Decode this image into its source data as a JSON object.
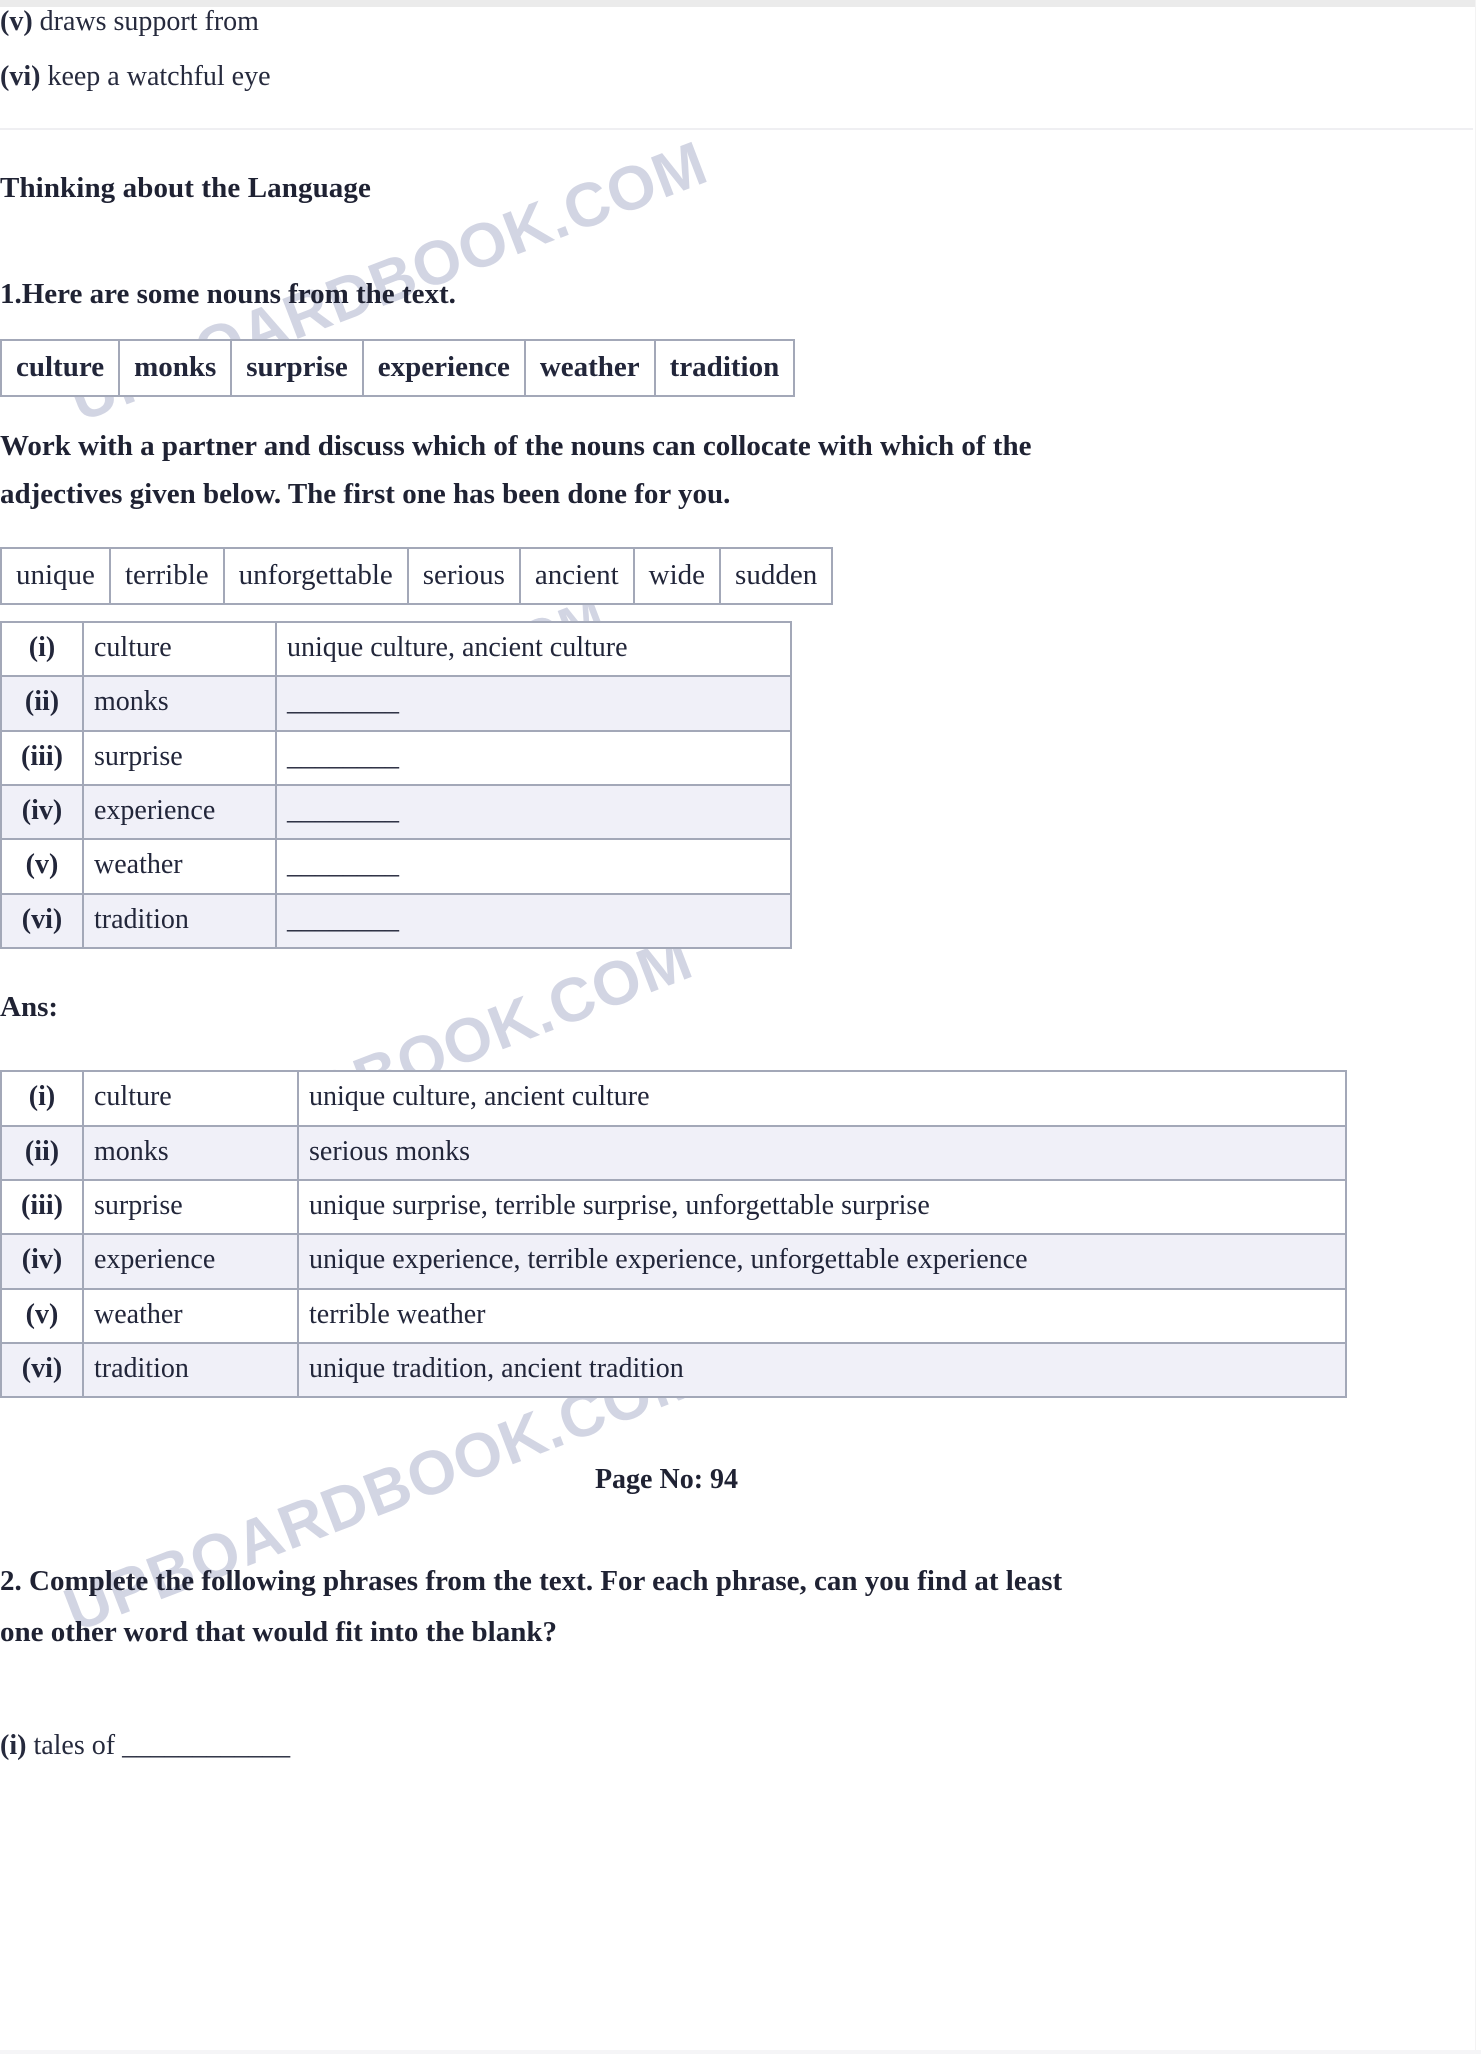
{
  "colors": {
    "text": "#22263a",
    "table_border": "#a3a8b8",
    "row_alt_bg": "#f0f0f8",
    "watermark": "#c9ccdd",
    "top_band": "#ebebeb"
  },
  "watermark": {
    "text": "UPBOARDBOOK.COM",
    "repeats": 4
  },
  "top_phrases": [
    {
      "numeral": "(v)",
      "text": "draws support from"
    },
    {
      "numeral": "(vi)",
      "text": "keep a watchful eye"
    }
  ],
  "section": {
    "title": "Thinking about the Language"
  },
  "question1": {
    "heading": "1.Here are some nouns from the text.",
    "nouns": [
      "culture",
      "monks",
      "surprise",
      "experience",
      "weather",
      "tradition"
    ],
    "instruction_line1": "Work with a partner and discuss which of the nouns can collocate with which of the",
    "instruction_line2": "adjectives given below. The first one has been done for you.",
    "adjectives": [
      "unique",
      "terrible",
      "unforgettable",
      "serious",
      "ancient",
      "wide",
      "sudden"
    ],
    "exercise_rows": [
      {
        "numeral": "(i)",
        "noun": "culture",
        "value": "unique culture, ancient culture"
      },
      {
        "numeral": "(ii)",
        "noun": "monks",
        "value": "________"
      },
      {
        "numeral": "(iii)",
        "noun": "surprise",
        "value": "________"
      },
      {
        "numeral": "(iv)",
        "noun": "experience",
        "value": "________"
      },
      {
        "numeral": "(v)",
        "noun": "weather",
        "value": "________"
      },
      {
        "numeral": "(vi)",
        "noun": "tradition",
        "value": "________"
      }
    ],
    "answer_label": "Ans:",
    "answer_rows": [
      {
        "numeral": "(i)",
        "noun": "culture",
        "value": "unique culture, ancient culture"
      },
      {
        "numeral": "(ii)",
        "noun": "monks",
        "value": "serious monks"
      },
      {
        "numeral": "(iii)",
        "noun": "surprise",
        "value": "unique surprise, terrible surprise, unforgettable surprise"
      },
      {
        "numeral": "(iv)",
        "noun": "experience",
        "value": "unique experience, terrible experience, unforgettable experience"
      },
      {
        "numeral": "(v)",
        "noun": "weather",
        "value": "terrible weather"
      },
      {
        "numeral": "(vi)",
        "noun": "tradition",
        "value": "unique tradition, ancient tradition"
      }
    ]
  },
  "page_marker": "Page No: 94",
  "question2": {
    "line1": "2. Complete the following phrases from the text. For each phrase, can you find at least",
    "line2": "one other word that would fit into the blank?",
    "items": [
      {
        "numeral": "(i)",
        "text": "tales of ____________"
      }
    ]
  }
}
